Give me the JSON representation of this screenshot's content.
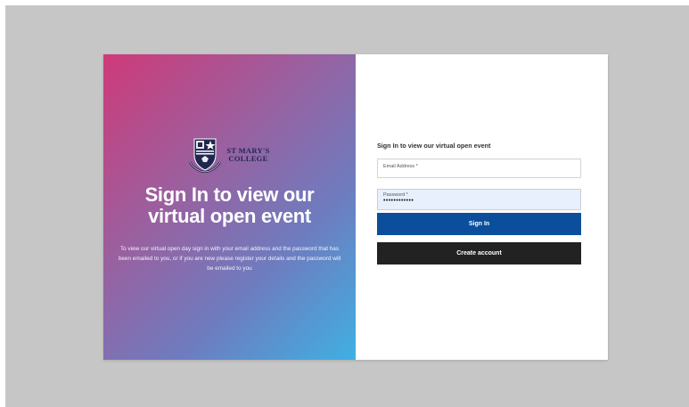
{
  "hero": {
    "logo_line1": "ST MARY'S",
    "logo_line2": "COLLEGE",
    "title_line1": "Sign In to view our",
    "title_line2": "virtual open event",
    "description": "To view our virtual open day sign in with your email address and the password that has been emailed to you, or if you are new please register your details and the password will be emailed to you"
  },
  "form": {
    "heading": "Sign In to view our virtual open event",
    "email_label": "Email Address *",
    "email_value": "",
    "password_label": "Password *",
    "password_value": "••••••••••••",
    "signin_label": "Sign In",
    "create_label": "Create account"
  },
  "colors": {
    "gradient_start": "#cf3a79",
    "gradient_end": "#3fb0e3",
    "signin_button": "#0b4f9c",
    "create_button": "#222222",
    "backdrop": "#c6c6c6"
  }
}
